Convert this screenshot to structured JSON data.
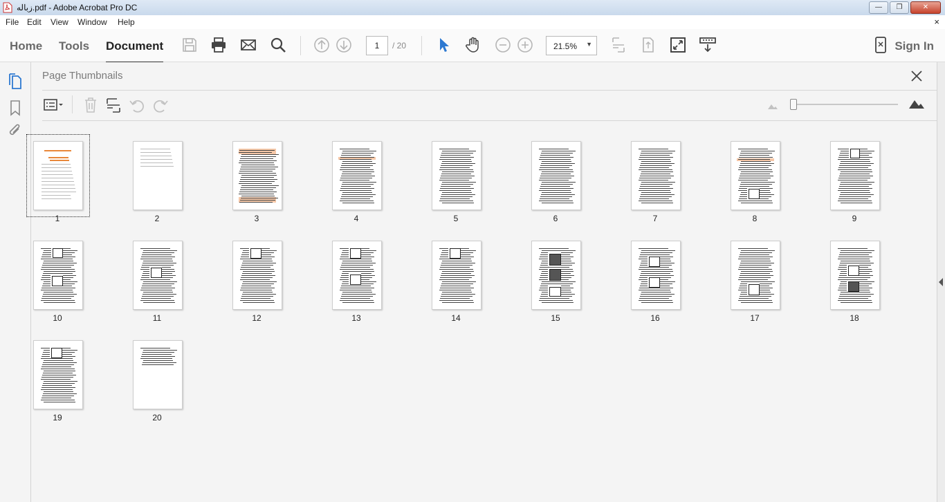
{
  "window": {
    "title": "زباله.pdf - Adobe Acrobat Pro DC",
    "buttons": [
      "minimize",
      "maximize",
      "close"
    ]
  },
  "menu": {
    "items": [
      "File",
      "Edit",
      "View",
      "Window",
      "Help"
    ],
    "close_glyph": "×"
  },
  "toolbar": {
    "tabs": [
      "Home",
      "Tools",
      "Document"
    ],
    "active_tab": "Document",
    "icons": [
      "save-icon",
      "print-icon",
      "email-icon",
      "search-icon",
      "page-up-icon",
      "page-down-icon",
      "select-arrow-icon",
      "hand-icon",
      "zoom-out-icon",
      "zoom-in-icon",
      "fit-page-icon",
      "scroll-mode-icon",
      "full-screen-icon",
      "read-mode-icon"
    ],
    "current_page": "1",
    "page_total": "/ 20",
    "zoom": "21.5%",
    "sign_in": "Sign In"
  },
  "left_rail": {
    "icons": [
      "page-thumbnails-icon",
      "bookmark-icon",
      "attachment-icon"
    ]
  },
  "panel": {
    "title": "Page Thumbnails",
    "tools": [
      "options-menu-icon",
      "delete-page-icon",
      "insert-page-icon",
      "rotate-ccw-icon",
      "rotate-cw-icon"
    ],
    "slider_level": 0.0
  },
  "thumbnails": {
    "labels": [
      "1",
      "2",
      "3",
      "4",
      "5",
      "6",
      "7",
      "8",
      "9",
      "10",
      "11",
      "12",
      "13",
      "14",
      "15",
      "16",
      "17",
      "18",
      "19",
      "20"
    ],
    "selected": "1"
  },
  "colors": {
    "accent_select": "#2d79d1",
    "thumb_highlight": "#e8873a",
    "titlebar": "#c9d9ec"
  }
}
